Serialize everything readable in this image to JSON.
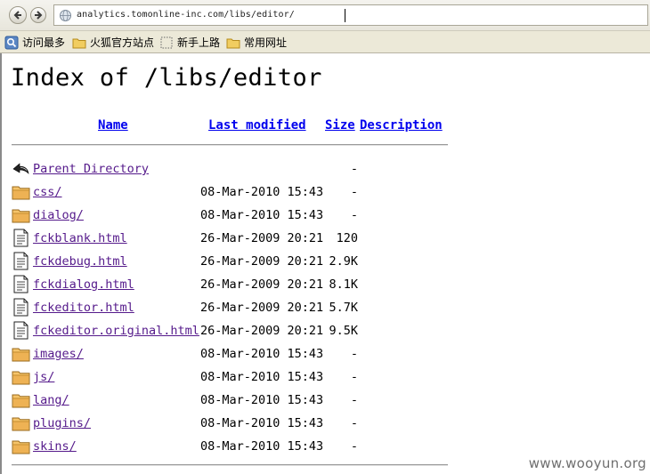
{
  "browser": {
    "url": "analytics.tomonline-inc.com/libs/editor/",
    "bookmarks": [
      {
        "label": "访问最多",
        "icon": "most-visited-icon"
      },
      {
        "label": "火狐官方站点",
        "icon": "folder-icon"
      },
      {
        "label": "新手上路",
        "icon": "dotted-page-icon"
      },
      {
        "label": "常用网址",
        "icon": "folder-icon"
      }
    ]
  },
  "page": {
    "title": "Index of /libs/editor",
    "columns": {
      "name": "Name",
      "last_modified": "Last modified",
      "size": "Size",
      "description": "Description"
    },
    "rows": [
      {
        "icon": "back-icon",
        "name": "Parent Directory",
        "date": "",
        "size": "-"
      },
      {
        "icon": "folder-icon",
        "name": "css/",
        "date": "08-Mar-2010 15:43",
        "size": "-"
      },
      {
        "icon": "folder-icon",
        "name": "dialog/",
        "date": "08-Mar-2010 15:43",
        "size": "-"
      },
      {
        "icon": "file-icon",
        "name": "fckblank.html",
        "date": "26-Mar-2009 20:21",
        "size": "120"
      },
      {
        "icon": "file-icon",
        "name": "fckdebug.html",
        "date": "26-Mar-2009 20:21",
        "size": "2.9K"
      },
      {
        "icon": "file-icon",
        "name": "fckdialog.html",
        "date": "26-Mar-2009 20:21",
        "size": "8.1K"
      },
      {
        "icon": "file-icon",
        "name": "fckeditor.html",
        "date": "26-Mar-2009 20:21",
        "size": "5.7K"
      },
      {
        "icon": "file-icon",
        "name": "fckeditor.original.html",
        "date": "26-Mar-2009 20:21",
        "size": "9.5K"
      },
      {
        "icon": "folder-icon",
        "name": "images/",
        "date": "08-Mar-2010 15:43",
        "size": "-"
      },
      {
        "icon": "folder-icon",
        "name": "js/",
        "date": "08-Mar-2010 15:43",
        "size": "-"
      },
      {
        "icon": "folder-icon",
        "name": "lang/",
        "date": "08-Mar-2010 15:43",
        "size": "-"
      },
      {
        "icon": "folder-icon",
        "name": "plugins/",
        "date": "08-Mar-2010 15:43",
        "size": "-"
      },
      {
        "icon": "folder-icon",
        "name": "skins/",
        "date": "08-Mar-2010 15:43",
        "size": "-"
      }
    ]
  },
  "watermark": "www.wooyun.org",
  "colors": {
    "link_unvisited": "#0000ee",
    "link_visited": "#551a8b",
    "folder": "#e8a93c",
    "chrome": "#ece9d8"
  }
}
